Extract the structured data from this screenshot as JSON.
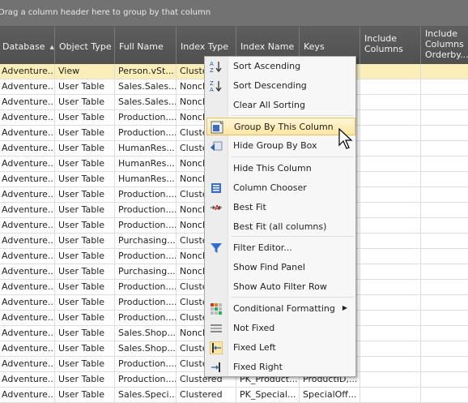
{
  "group_panel": {
    "hint": "Drag a column header here to group by that column"
  },
  "columns": [
    "Database",
    "Object Type",
    "Full Name",
    "Index Type",
    "Index Name",
    "Keys",
    "Include\nColumns",
    "Include\nColumns\nOrderby..."
  ],
  "rows": [
    [
      "Adventure...",
      "View",
      "Person.vSt...",
      "Clustered",
      "",
      "",
      "",
      ""
    ],
    [
      "Adventure...",
      "User Table",
      "Sales.Sales...",
      "Nonclu",
      "",
      "",
      "",
      ""
    ],
    [
      "Adventure...",
      "User Table",
      "Sales.Sales...",
      "Nonclu",
      "",
      "",
      "",
      ""
    ],
    [
      "Adventure...",
      "User Table",
      "Production....",
      "Nonclu",
      "",
      "",
      "",
      ""
    ],
    [
      "Adventure...",
      "User Table",
      "Production....",
      "Cluste",
      "",
      "",
      "",
      ""
    ],
    [
      "Adventure...",
      "User Table",
      "HumanRes...",
      "Cluste",
      "",
      "",
      "",
      ""
    ],
    [
      "Adventure...",
      "User Table",
      "HumanRes...",
      "Nonclu",
      "",
      "",
      "",
      ""
    ],
    [
      "Adventure...",
      "User Table",
      "HumanRes...",
      "Nonclu",
      "",
      "",
      "",
      ""
    ],
    [
      "Adventure...",
      "User Table",
      "Production....",
      "Cluste",
      "",
      "",
      "",
      ""
    ],
    [
      "Adventure...",
      "User Table",
      "Production....",
      "Nonclu",
      "",
      "",
      "",
      ""
    ],
    [
      "Adventure...",
      "User Table",
      "Production....",
      "Nonclu",
      "",
      "",
      "",
      ""
    ],
    [
      "Adventure...",
      "User Table",
      "Purchasing....",
      "Cluste",
      "",
      "",
      "",
      ""
    ],
    [
      "Adventure...",
      "User Table",
      "Production....",
      "Nonclu",
      "",
      "",
      "",
      ""
    ],
    [
      "Adventure...",
      "User Table",
      "Purchasing....",
      "Nonclu",
      "",
      "",
      "",
      ""
    ],
    [
      "Adventure...",
      "User Table",
      "Production....",
      "Cluste",
      "",
      "",
      "",
      ""
    ],
    [
      "Adventure...",
      "User Table",
      "Production....",
      "Cluste",
      "",
      "",
      "",
      ""
    ],
    [
      "Adventure...",
      "User Table",
      "Production....",
      "Cluste",
      "",
      "",
      "",
      ""
    ],
    [
      "Adventure...",
      "User Table",
      "Sales.Shop...",
      "Nonclu",
      "",
      "",
      "",
      ""
    ],
    [
      "Adventure...",
      "User Table",
      "Sales.Shop...",
      "Cluste",
      "",
      "",
      "",
      ""
    ],
    [
      "Adventure...",
      "User Table",
      "Production....",
      "Cluste",
      "",
      "",
      "",
      ""
    ],
    [
      "Adventure...",
      "User Table",
      "Production....",
      "Clustered",
      "PK_Product...",
      "ProductID,...",
      "",
      ""
    ],
    [
      "Adventure...",
      "User Table",
      "Sales.Speci...",
      "Clustered",
      "PK_Special...",
      "SpecialOff...",
      "",
      ""
    ]
  ],
  "context_menu": {
    "items": [
      {
        "label": "Sort Ascending",
        "icon": "sort-ascending-icon"
      },
      {
        "label": "Sort Descending",
        "icon": "sort-descending-icon"
      },
      {
        "label": "Clear All Sorting",
        "icon": ""
      },
      {
        "label": "Group By This Column",
        "icon": "group-by-column-icon",
        "highlighted": true
      },
      {
        "label": "Hide Group By Box",
        "icon": "hide-group-box-icon"
      },
      {
        "label": "Hide This Column",
        "icon": ""
      },
      {
        "label": "Column Chooser",
        "icon": "column-chooser-icon"
      },
      {
        "label": "Best Fit",
        "icon": "best-fit-icon"
      },
      {
        "label": "Best Fit (all columns)",
        "icon": ""
      },
      {
        "label": "Filter Editor...",
        "icon": "filter-icon"
      },
      {
        "label": "Show Find Panel",
        "icon": ""
      },
      {
        "label": "Show Auto Filter Row",
        "icon": ""
      },
      {
        "label": "Conditional Formatting",
        "icon": "conditional-formatting-icon",
        "submenu": true
      },
      {
        "label": "Not Fixed",
        "icon": "not-fixed-icon"
      },
      {
        "label": "Fixed Left",
        "icon": "fixed-left-icon"
      },
      {
        "label": "Fixed Right",
        "icon": "fixed-right-icon"
      }
    ],
    "colors": {
      "highlight": "#fbe6a2",
      "highlight_border": "#e5c365"
    }
  },
  "colors": {
    "header_bg": "#555555",
    "selected_row": "#fbeeb8",
    "group_panel": "#727272"
  }
}
